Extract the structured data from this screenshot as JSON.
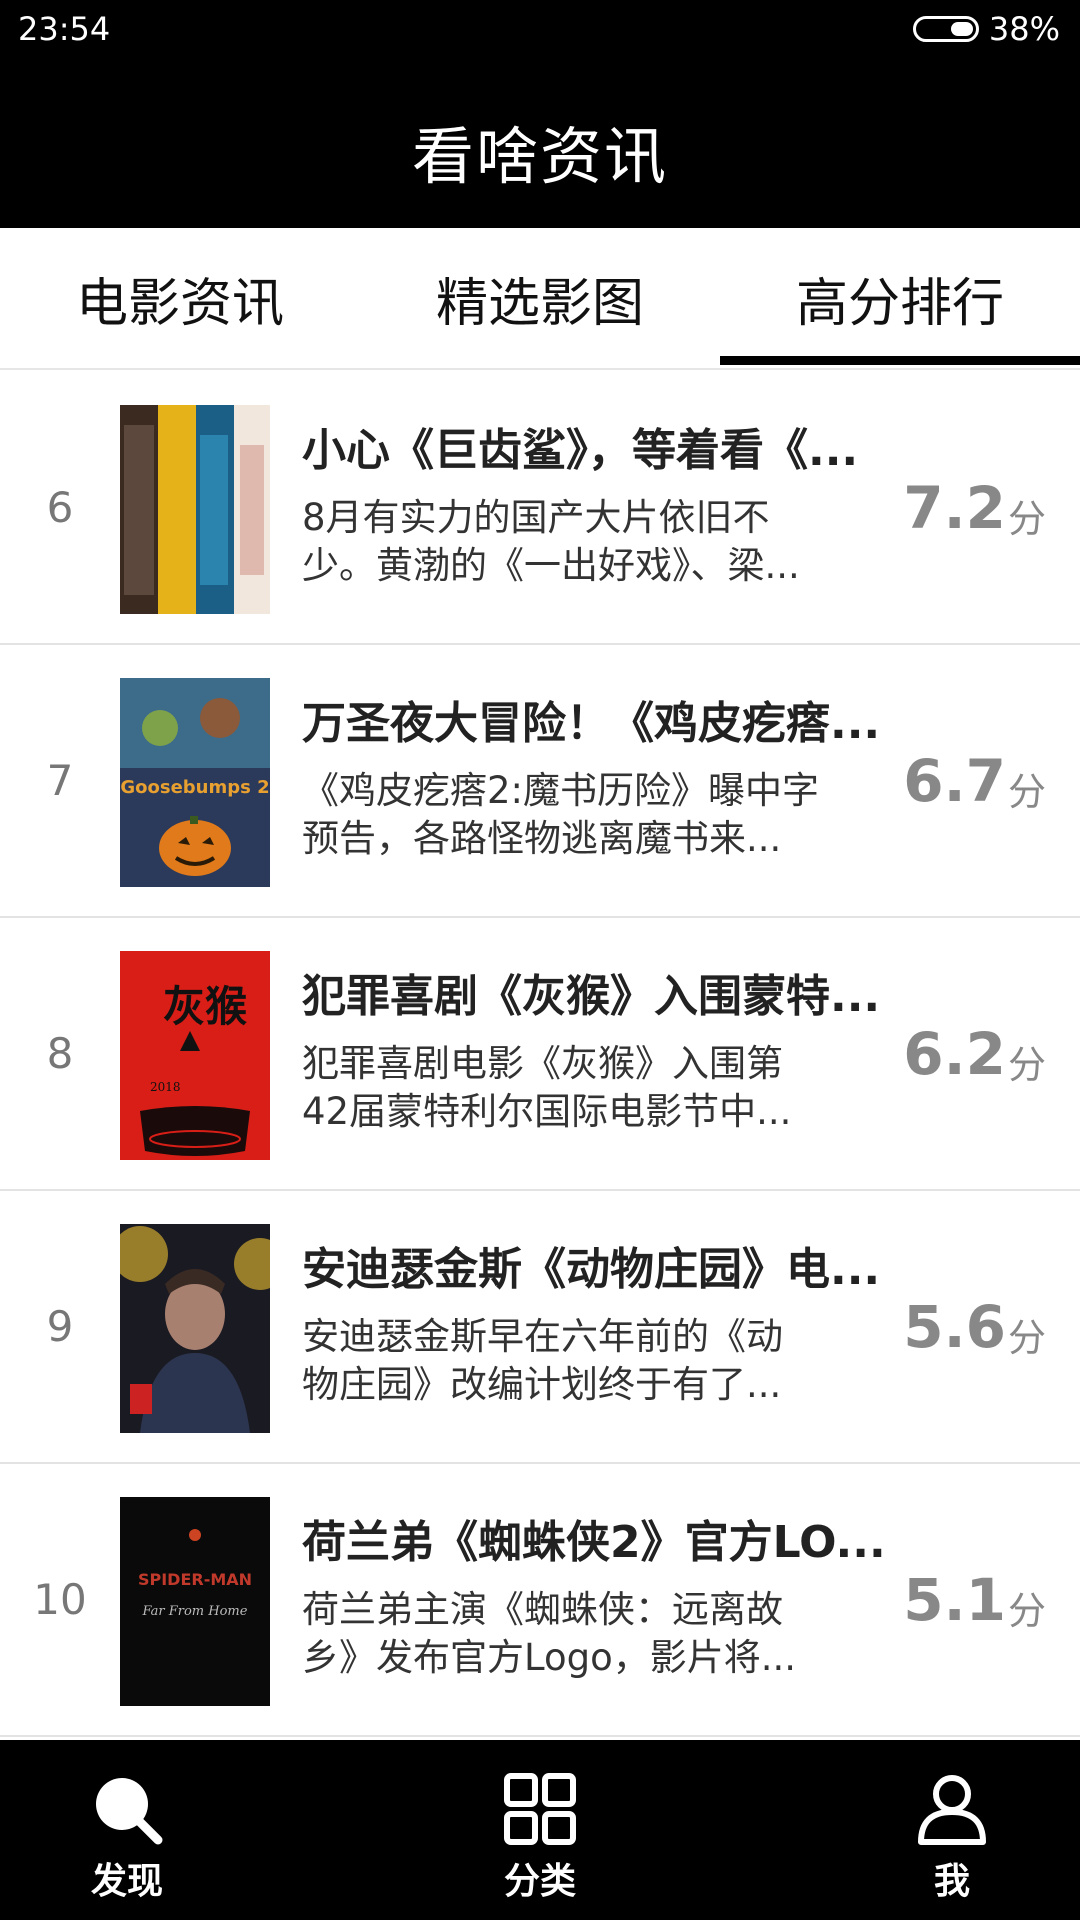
{
  "status": {
    "time": "23:54",
    "battery": "38%"
  },
  "header": {
    "title": "看啥资讯"
  },
  "tabs": [
    {
      "label": "电影资讯",
      "active": false
    },
    {
      "label": "精选影图",
      "active": false
    },
    {
      "label": "高分排行",
      "active": true
    }
  ],
  "rankings": [
    {
      "rank": "6",
      "title": "小心《巨齿鲨》，等着看《...",
      "desc_line1": "8月有实力的国产大片依旧不",
      "desc_line2": "少。黄渤的《一出好戏》、梁...",
      "score": "7.2",
      "unit": "分"
    },
    {
      "rank": "7",
      "title": "万圣夜大冒险！《鸡皮疙瘩...",
      "desc_line1": "《鸡皮疙瘩2:魔书历险》曝中字",
      "desc_line2": "预告，各路怪物逃离魔书来...",
      "score": "6.7",
      "unit": "分",
      "poster_text": "Goosebumps 2"
    },
    {
      "rank": "8",
      "title": "犯罪喜剧《灰猴》入围蒙特...",
      "desc_line1": "犯罪喜剧电影《灰猴》入围第",
      "desc_line2": "42届蒙特利尔国际电影节中...",
      "score": "6.2",
      "unit": "分",
      "poster_text": "灰猴",
      "poster_year": "2018"
    },
    {
      "rank": "9",
      "title": "安迪瑟金斯《动物庄园》电...",
      "desc_line1": "安迪瑟金斯早在六年前的《动",
      "desc_line2": "物庄园》改编计划终于有了...",
      "score": "5.6",
      "unit": "分"
    },
    {
      "rank": "10",
      "title": "荷兰弟《蜘蛛侠2》官方LO...",
      "desc_line1": "荷兰弟主演《蜘蛛侠：远离故",
      "desc_line2": "乡》发布官方Logo，影片将...",
      "score": "5.1",
      "unit": "分",
      "poster_text": "SPIDER-MAN",
      "poster_sub": "Far From Home"
    }
  ],
  "bottom_nav": [
    {
      "label": "发现",
      "icon": "search-icon"
    },
    {
      "label": "分类",
      "icon": "grid-icon"
    },
    {
      "label": "我",
      "icon": "user-icon"
    }
  ]
}
